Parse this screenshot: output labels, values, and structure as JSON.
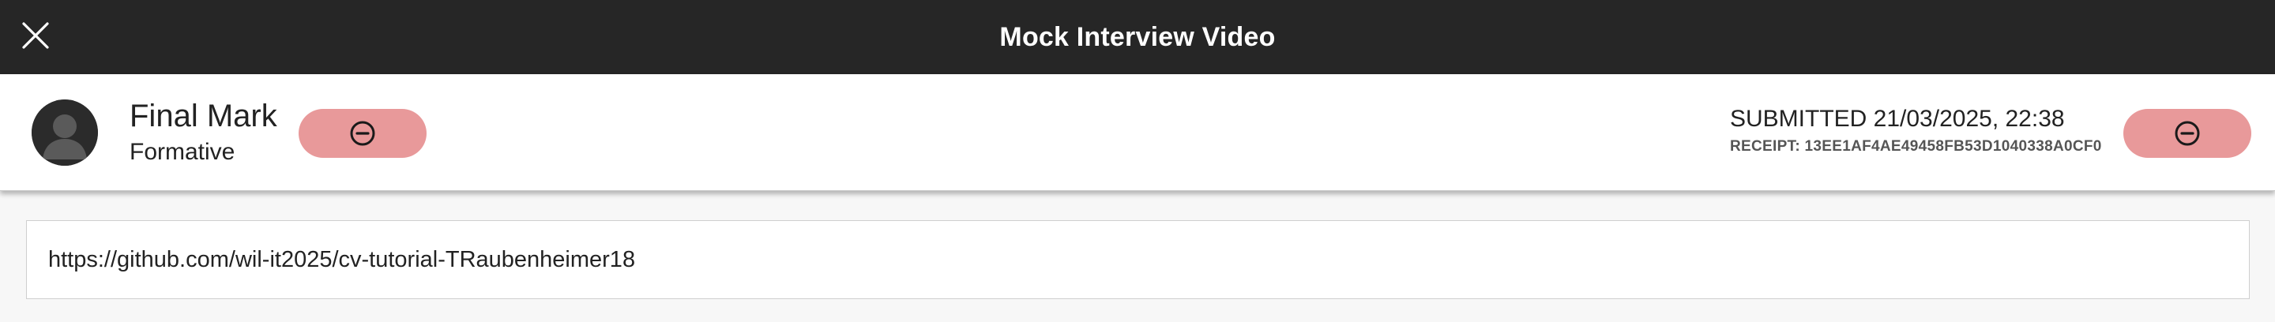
{
  "topbar": {
    "title": "Mock Interview Video",
    "close_icon": "close-icon"
  },
  "header": {
    "avatar_icon": "user-avatar-icon",
    "mark_title": "Final Mark",
    "mark_subtitle": "Formative",
    "status_pill_icon": "minus-circle-icon",
    "submitted": "SUBMITTED 21/03/2025, 22:38",
    "receipt": "RECEIPT: 13EE1AF4AE49458FB53D1040338A0CF0",
    "pill_color": "#e8999a"
  },
  "submission": {
    "url": "https://github.com/wil-it2025/cv-tutorial-TRaubenheimer18"
  },
  "colors": {
    "topbar_bg": "#262626",
    "page_bg": "#f7f7f7"
  }
}
